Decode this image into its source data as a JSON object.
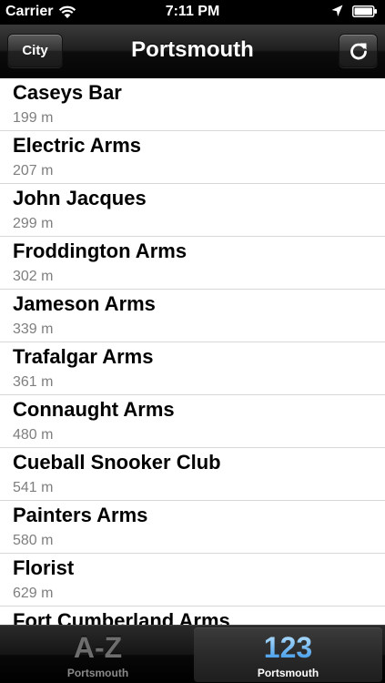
{
  "status_bar": {
    "carrier": "Carrier",
    "time": "7:11 PM",
    "wifi_icon": "wifi-icon",
    "location_icon": "location-arrow-icon",
    "battery_icon": "battery-icon"
  },
  "nav": {
    "title": "Portsmouth",
    "left_button": "City",
    "right_icon": "refresh-icon"
  },
  "list": {
    "items": [
      {
        "name": "Caseys Bar",
        "distance": "199 m"
      },
      {
        "name": "Electric Arms",
        "distance": "207 m"
      },
      {
        "name": "John Jacques",
        "distance": "299 m"
      },
      {
        "name": "Froddington Arms",
        "distance": "302 m"
      },
      {
        "name": "Jameson Arms",
        "distance": "339 m"
      },
      {
        "name": "Trafalgar Arms",
        "distance": "361 m"
      },
      {
        "name": "Connaught Arms",
        "distance": "480 m"
      },
      {
        "name": "Cueball Snooker Club",
        "distance": "541 m"
      },
      {
        "name": "Painters Arms",
        "distance": "580 m"
      },
      {
        "name": "Florist",
        "distance": "629 m"
      },
      {
        "name": "Fort Cumberland Arms",
        "distance": ""
      }
    ]
  },
  "tabs": [
    {
      "glyph": "A-Z",
      "label": "Portsmouth",
      "selected": false
    },
    {
      "glyph": "123",
      "label": "Portsmouth",
      "selected": true
    }
  ],
  "colors": {
    "accent": "#5db3ff",
    "secondary_text": "#7f7f7f"
  }
}
